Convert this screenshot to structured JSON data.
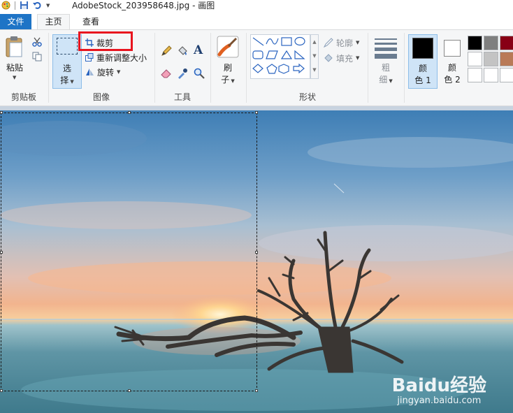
{
  "window": {
    "title": "AdobeStock_203958648.jpg - 画图"
  },
  "tabs": {
    "file": "文件",
    "home": "主页",
    "view": "查看"
  },
  "clipboard": {
    "paste": "粘贴",
    "group": "剪贴板"
  },
  "image": {
    "select_top": "选",
    "select_bottom": "择",
    "crop": "裁剪",
    "resize": "重新调整大小",
    "rotate": "旋转",
    "group": "图像"
  },
  "tools": {
    "group": "工具"
  },
  "brushes": {
    "top": "刷",
    "bottom": "子"
  },
  "shapes": {
    "outline": "轮廓",
    "fill": "填充",
    "group": "形状"
  },
  "size": {
    "top": "粗",
    "bottom": "细"
  },
  "color1": {
    "top": "颜",
    "bottom": "色 1"
  },
  "color2": {
    "top": "颜",
    "bottom": "色 2"
  },
  "palette": [
    "#000000",
    "#7f7f7f",
    "#880015",
    "#ffffff",
    "#c3c3c3",
    "#b97a57",
    "#ffffff",
    "#ffffff",
    "#ffffff"
  ],
  "colors": {
    "accent": "#1e74c6",
    "crop_highlight": "#e8141e",
    "color1": "#000000",
    "color2": "#ffffff"
  },
  "watermark": {
    "main": "Baidu经验",
    "sub": "jingyan.baidu.com"
  }
}
